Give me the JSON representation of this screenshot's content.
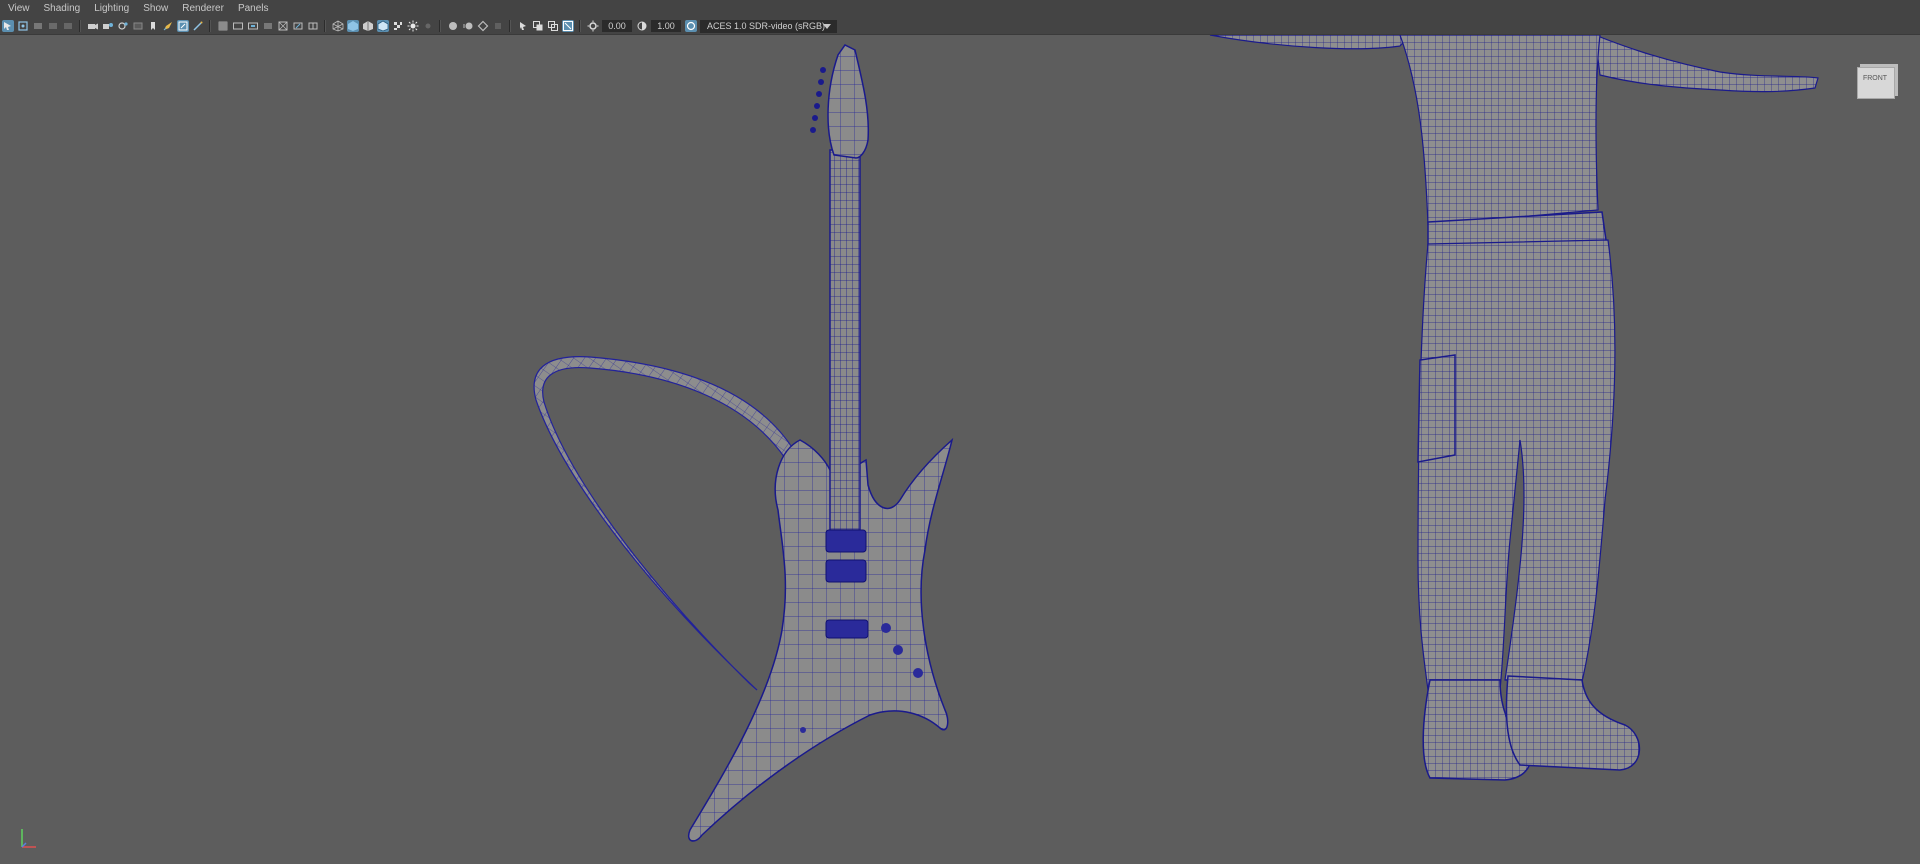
{
  "menubar": {
    "items": [
      {
        "label": "View"
      },
      {
        "label": "Shading"
      },
      {
        "label": "Lighting"
      },
      {
        "label": "Show"
      },
      {
        "label": "Renderer"
      },
      {
        "label": "Panels"
      }
    ]
  },
  "toolbar": {
    "exposure_value": "0.00",
    "gamma_value": "1.00",
    "color_space": "ACES 1.0 SDR-video (sRGB)"
  },
  "viewport": {
    "viewcube_label": "FRONT",
    "wireframe_color": "#1a1a8c",
    "background_color": "#5d5d5d",
    "objects": [
      "guitar-with-strap",
      "character-body"
    ]
  },
  "colors": {
    "panel": "#444444",
    "field": "#2b2b2b",
    "active_icon": "#5b8fb0",
    "text": "#c8c8c8"
  }
}
